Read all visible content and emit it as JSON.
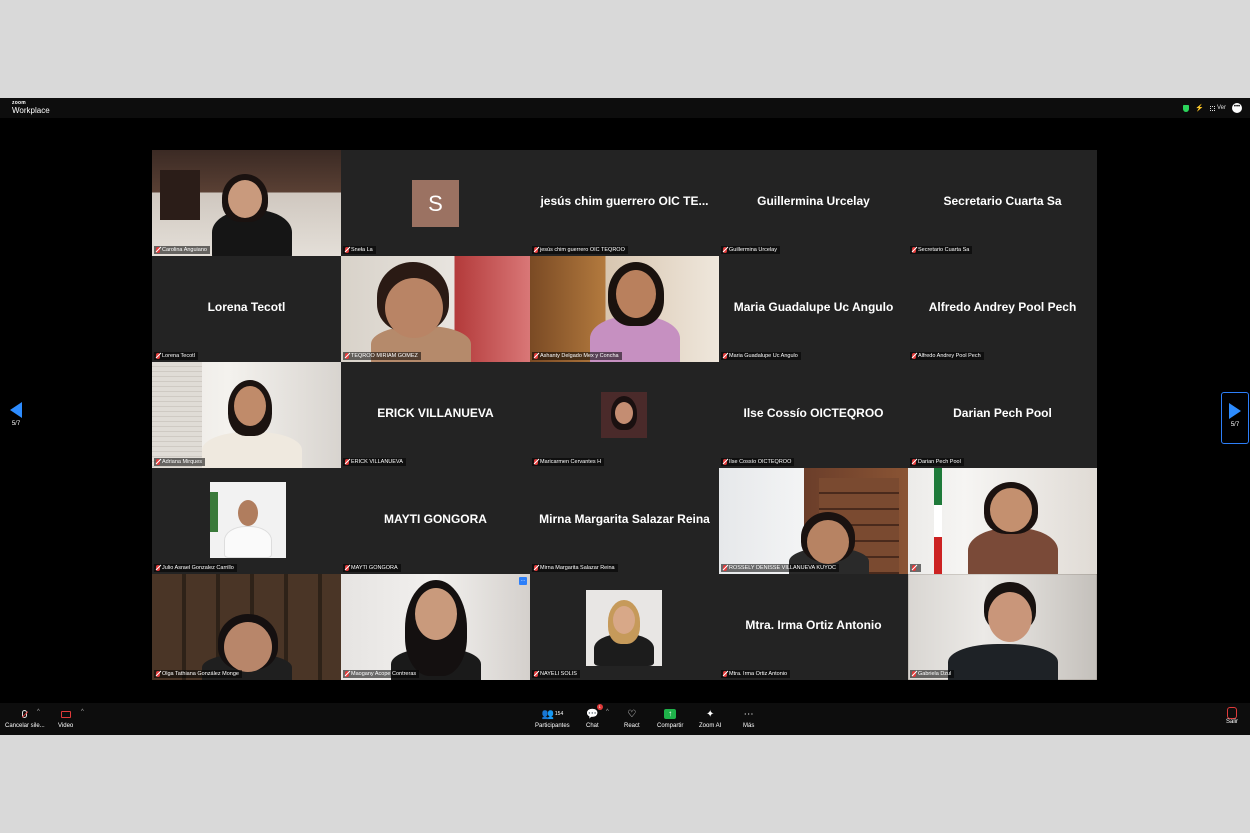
{
  "app": {
    "brand_small": "zoom",
    "brand": "Workplace",
    "view_label": "Ver"
  },
  "gallery": {
    "tiles": [
      {
        "name": "Carolina Anguiano",
        "display": "",
        "video": true
      },
      {
        "name": "Sneła La",
        "display": "",
        "avatar_letter": "S",
        "video": false
      },
      {
        "name": "jesús chim guerrero OIC TEQROO",
        "display": "jesús chim guerrero OIC TE...",
        "video": false
      },
      {
        "name": "Guillermina Urcelay",
        "display": "Guillermina Urcelay",
        "video": false
      },
      {
        "name": "Secretario Cuarta Sa",
        "display": "Secretario Cuarta Sa",
        "video": false
      },
      {
        "name": "Lorena Tecotl",
        "display": "Lorena Tecotl",
        "video": false
      },
      {
        "name": "TEQROO MIRIAM GOMEZ",
        "display": "",
        "video": true
      },
      {
        "name": "Ashanty Delgado Mex y Concha",
        "display": "",
        "video": true
      },
      {
        "name": "Maria Guadalupe Uc Angulo",
        "display": "Maria Guadalupe Uc Angulo",
        "video": false
      },
      {
        "name": "Alfredo Andrey Pool Pech",
        "display": "Alfredo Andrey Pool Pech",
        "video": false
      },
      {
        "name": "Adriana Mirques",
        "display": "",
        "video": true
      },
      {
        "name": "ERICK VILLANUEVA",
        "display": "ERICK VILLANUEVA",
        "video": false
      },
      {
        "name": "Maricarmen Cervantes H",
        "display": "",
        "video": false
      },
      {
        "name": "Ilse Cossío OICTEQROO",
        "display": "Ilse Cossío OICTEQROO",
        "video": false
      },
      {
        "name": "Darian Pech Pool",
        "display": "Darian Pech Pool",
        "video": false
      },
      {
        "name": "Julio Asrael Gonzalez Carrillo",
        "display": "",
        "video": false
      },
      {
        "name": "MAYTI GONGORA",
        "display": "MAYTI GONGORA",
        "video": false
      },
      {
        "name": "Mirna Margarita Salazar Reina",
        "display": "Mirna Margarita Salazar Reina",
        "video": false
      },
      {
        "name": "ROSSELY DENISSE VILLANUEVA KUYOC",
        "display": "",
        "video": true
      },
      {
        "name": "",
        "display": "",
        "video": true
      },
      {
        "name": "Olga Tathiana González Monge",
        "display": "",
        "video": true
      },
      {
        "name": "Maogany Acope Contreras",
        "display": "",
        "video": true
      },
      {
        "name": "NAYELI SOLIS",
        "display": "",
        "video": false
      },
      {
        "name": "Mtra. Irma Ortiz Antonio",
        "display": "Mtra. Irma Ortiz Antonio",
        "video": false
      },
      {
        "name": "Gabriela Dzul",
        "display": "",
        "video": true
      }
    ]
  },
  "pagination": {
    "left": "5/7",
    "right": "5/7"
  },
  "toolbar": {
    "mute_label": "Cancelar sile...",
    "video_label": "Video",
    "participants_label": "Participantes",
    "participants_count": "154",
    "chat_label": "Chat",
    "chat_badge": "1",
    "react_label": "React",
    "share_label": "Compartir",
    "zoomai_label": "Zoom AI",
    "more_label": "Más",
    "leave_label": "Salir"
  },
  "colors": {
    "accent": "#2d8cff",
    "share_green": "#1fb24a",
    "mute_red": "#e03a3a",
    "tile_bg": "#232323"
  }
}
